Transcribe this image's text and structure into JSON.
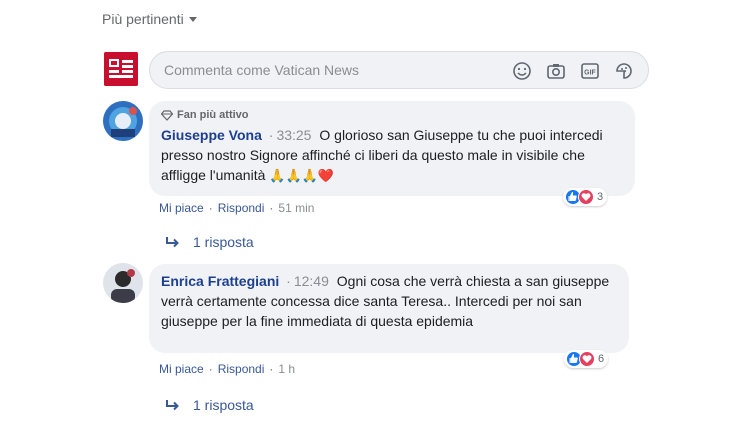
{
  "sort": {
    "label": "Più pertinenti"
  },
  "composer": {
    "placeholder": "Commenta come Vatican News"
  },
  "comments": [
    {
      "badge": "Fan più attivo",
      "author": "Giuseppe Vona",
      "time": "33:25",
      "text": "O glorioso san Giuseppe tu che puoi intercedi presso nostro Signore affinché ci liberi da questo male in visibile che affligge l'umanità",
      "emoji": "🙏🙏🙏❤️",
      "like_label": "Mi piace",
      "reply_label": "Rispondi",
      "age": "51 min",
      "reaction_count": "3",
      "replies_label": "1 risposta"
    },
    {
      "author": "Enrica Frattegiani",
      "time": "12:49",
      "text": "Ogni cosa che verrà chiesta a san giuseppe verrà certamente concessa dice santa Teresa.. Intercedi per noi san giuseppe per la fine immediata di questa epidemia",
      "like_label": "Mi piace",
      "reply_label": "Rispondi",
      "age": "1 h",
      "reaction_count": "6",
      "replies_label": "1 risposta"
    }
  ],
  "colors": {
    "author": "#1c3f8f",
    "like": "#1877f2",
    "love": "#e4405f",
    "brand_red": "#c8102e"
  }
}
